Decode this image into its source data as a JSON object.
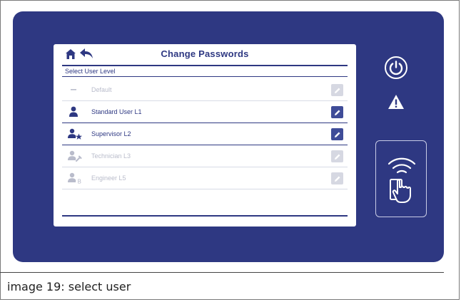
{
  "screen": {
    "title": "Change Passwords",
    "section_label": "Select User Level"
  },
  "user_levels": [
    {
      "label": "Default",
      "icon": "dash-icon",
      "enabled": false
    },
    {
      "label": "Standard User L1",
      "icon": "user-icon",
      "enabled": true
    },
    {
      "label": "Supervisor L2",
      "icon": "user-star-icon",
      "enabled": true
    },
    {
      "label": "Technician L3",
      "icon": "user-wrench-icon",
      "enabled": false
    },
    {
      "label": "Engineer L5",
      "icon": "user-b-icon",
      "enabled": false
    }
  ],
  "caption": "image 19: select user",
  "colors": {
    "panel": "#2e3882",
    "accent": "#3f4c98",
    "disabled": "#b9bccb"
  }
}
